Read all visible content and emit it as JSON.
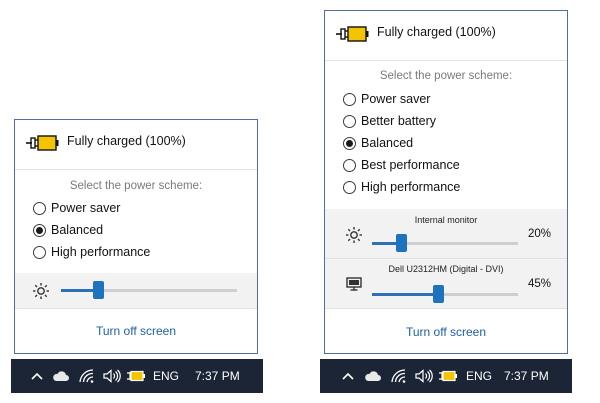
{
  "left_flyout": {
    "battery_status": "Fully charged (100%)",
    "scheme_title": "Select the power scheme:",
    "schemes": [
      {
        "label": "Power saver",
        "checked": false
      },
      {
        "label": "Balanced",
        "checked": true
      },
      {
        "label": "High performance",
        "checked": false
      }
    ],
    "brightness_level": 0.21,
    "turn_off_label": "Turn off screen"
  },
  "right_flyout": {
    "battery_status": "Fully charged (100%)",
    "scheme_title": "Select the power scheme:",
    "schemes": [
      {
        "label": "Power saver",
        "checked": false
      },
      {
        "label": "Better battery",
        "checked": false
      },
      {
        "label": "Balanced",
        "checked": true
      },
      {
        "label": "Best performance",
        "checked": false
      },
      {
        "label": "High performance",
        "checked": false
      }
    ],
    "monitors": [
      {
        "name": "Internal monitor",
        "percent_text": "20%",
        "level": 0.2
      },
      {
        "name": "Dell U2312HM (Digital - DVI)",
        "percent_text": "45%",
        "level": 0.45
      }
    ],
    "turn_off_label": "Turn off screen"
  },
  "taskbar": {
    "language": "ENG",
    "time": "7:37 PM",
    "icons": [
      "chevron-up-icon",
      "cloud-icon",
      "wifi-icon",
      "speaker-icon",
      "battery-icon"
    ]
  },
  "colors": {
    "accent": "#1e73be",
    "battery_fill": "#f5c400",
    "taskbar_bg": "#1c2536",
    "link": "#1f5fa8",
    "flyout_border": "#4f6fa3"
  }
}
